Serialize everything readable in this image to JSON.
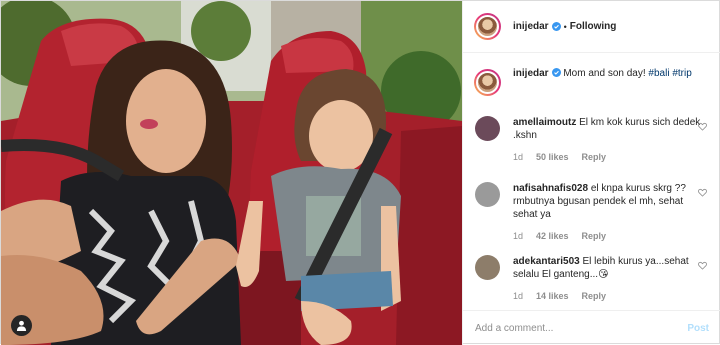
{
  "header": {
    "username": "inijedar",
    "separator": "•",
    "follow_state": "Following"
  },
  "caption": {
    "username": "inijedar",
    "text": " Mom and son day! ",
    "hashtags": [
      "#bali",
      "#trip"
    ]
  },
  "comments": [
    {
      "username": "amellaimoutz",
      "text": "El km kok kurus sich dedek .kshn",
      "time": "1d",
      "likes": "50 likes",
      "reply": "Reply",
      "avatar_color": "#6b4a5a"
    },
    {
      "username": "nafisahnafis028",
      "text": "el knpa kurus skrg ?? rmbutnya bgusan pendek el mh, sehat sehat ya",
      "time": "1d",
      "likes": "42 likes",
      "reply": "Reply",
      "avatar_color": "#9a9a9a"
    },
    {
      "username": "adekantari503",
      "text": "El lebih kurus ya...sehat selalu El ganteng...",
      "emoji": "😘",
      "time": "1d",
      "likes": "14 likes",
      "reply": "Reply",
      "avatar_color": "#8d7d6a"
    }
  ],
  "add_comment": {
    "placeholder": "Add a comment...",
    "post_label": "Post"
  },
  "colors": {
    "link": "#00376b",
    "verified": "#3897f0",
    "post_disabled": "#b2dffc",
    "muted": "#8e8e8e"
  },
  "icons": [
    "verified-badge-icon",
    "heart-icon",
    "user-tag-icon"
  ]
}
